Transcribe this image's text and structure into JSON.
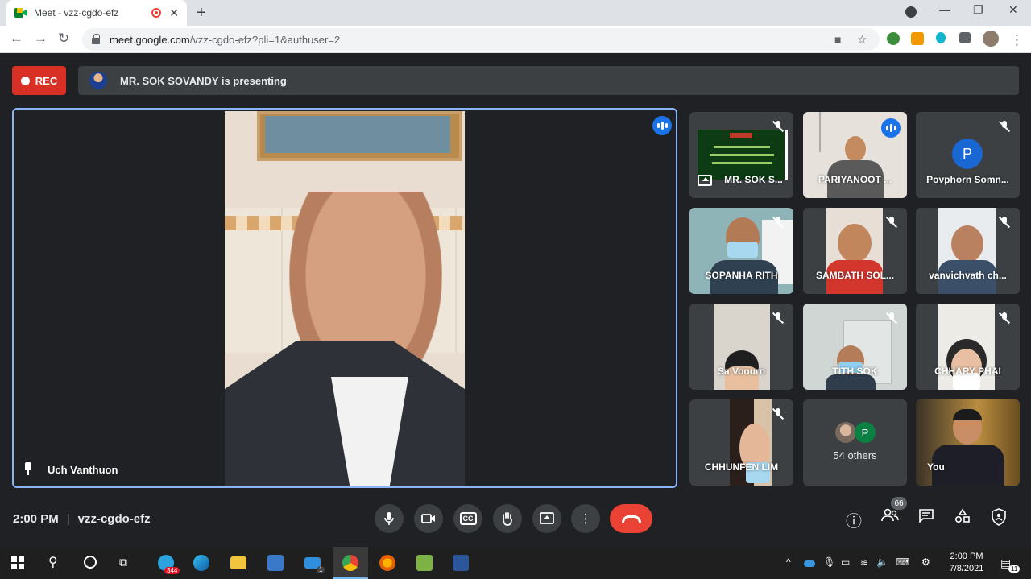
{
  "browser": {
    "tab_title": "Meet - vzz-cgdo-efz",
    "tab_close": "✕",
    "new_tab": "+",
    "url_host": "meet.google.com",
    "url_path": "/vzz-cgdo-efz?pli=1&authuser=2",
    "win_minimize": "—",
    "win_maximize": "❐",
    "win_close": "✕"
  },
  "meet": {
    "rec_label": "REC",
    "presenting_text": "MR. SOK SOVANDY is presenting",
    "main_speaker_name": "Uch Vanthuon",
    "participants": [
      {
        "name": "MR. SOK S...",
        "muted": true
      },
      {
        "name": "PARIYANOOT ...",
        "muted": false
      },
      {
        "name": "Povphorn Somn...",
        "muted": true,
        "avatar_letter": "P"
      },
      {
        "name": "SOPANHA RITH",
        "muted": true
      },
      {
        "name": "SAMBATH SOL...",
        "muted": true
      },
      {
        "name": "vanvichvath ch...",
        "muted": true
      },
      {
        "name": "Sa Voourn",
        "muted": true
      },
      {
        "name": "TITH SOK",
        "muted": true
      },
      {
        "name": "CHHARY PHAI",
        "muted": true
      },
      {
        "name": "CHHUNFEN LIM",
        "muted": true
      },
      {
        "name": "54 others",
        "avatar_letter": "P"
      },
      {
        "name": "You",
        "muted": false
      }
    ],
    "time": "2:00 PM",
    "separator": "|",
    "meeting_code": "vzz-cgdo-efz",
    "people_count": "66",
    "cc_label": "CC"
  },
  "taskbar": {
    "time": "2:00 PM",
    "date": "7/8/2021",
    "telegram_badge": "344",
    "mail_badge": "1",
    "notif_count": "11"
  },
  "colors": {
    "accent": "#1a73e8",
    "rec": "#d93025",
    "hangup": "#ea4335",
    "tile_border": "#8ab4f8"
  }
}
